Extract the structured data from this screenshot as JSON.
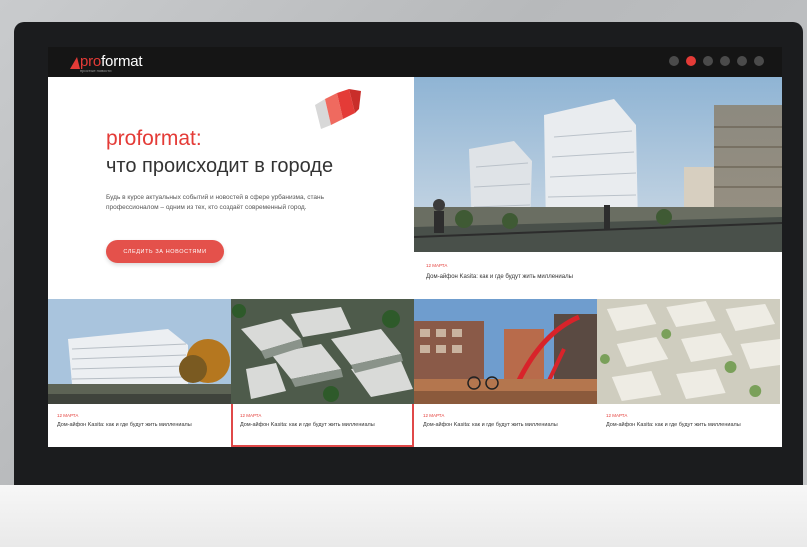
{
  "site": {
    "logo_pre": "pro",
    "logo_post": "format",
    "logo_tagline": "простые новости"
  },
  "slider": {
    "total": 6,
    "active_index": 1
  },
  "hero": {
    "title_accent": "proformat:",
    "title": "что происходит в городе",
    "text": "Будь в курсе актуальных событий и новостей в сфере урбанизма, стань профессионалом – одним из тех, кто создаёт современный город.",
    "button_label": "следить за новостями"
  },
  "featured_news": {
    "date": "12 МАРТА",
    "title": "Дом-айфон Kasita: как и где будут жить миллениалы"
  },
  "news_cards": [
    {
      "date": "12 МАРТА",
      "title": "Дом-айфон Kasita: как и где будут жить миллениалы",
      "selected": false
    },
    {
      "date": "12 МАРТА",
      "title": "Дом-айфон Kasita: как и где будут жить миллениалы",
      "selected": true
    },
    {
      "date": "12 МАРТА",
      "title": "Дом-айфон Kasita: как и где будут жить миллениалы",
      "selected": false
    },
    {
      "date": "12 МАРТА",
      "title": "Дом-айфон Kasita: как и где будут жить миллениалы",
      "selected": false
    }
  ],
  "colors": {
    "accent": "#e43b37",
    "header_bg": "#151515",
    "monitor_bezel": "#1b1c1e"
  }
}
